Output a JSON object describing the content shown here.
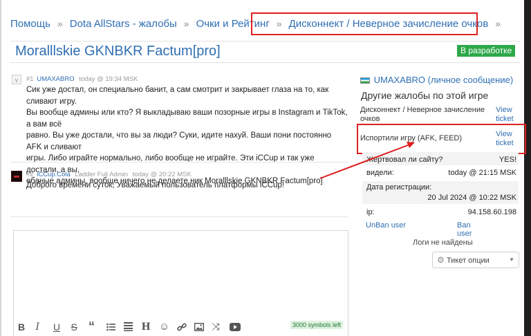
{
  "breadcrumb": {
    "items": [
      "Помощь",
      "Dota AllStars - жалобы",
      "Очки и Рейтинг",
      "Дисконнект / Неверное зачисление очков"
    ],
    "separator": "»"
  },
  "page": {
    "title": "Moralllskie GKNBKR Factum[pro]",
    "status": "В разработке"
  },
  "posts": [
    {
      "num": "#1",
      "author": "UMAXABRO",
      "role": "",
      "time": "today @ 19:34 MSK",
      "lines": [
        "Сик уже достал, он специально банит, а сам смотрит и закрывает глаза на то, как сливают игру.",
        "Вы вообще админы или кто? Я выкладываю ваши позорные игры в Instagram и TikTok, а вам всё",
        "равно. Вы уже достали, что вы за люди? Суки, идите нахуй. Ваши пони постоянно AFK и сливают",
        "игры. Либо играйте нормально, либо вообще не играйте. Эти iCCup и так уже достали, а вы,",
        "ебаные админы, вообще ничего не делаете ник Moralllskie GKNBKR Factum[pro]"
      ]
    },
    {
      "num": "#2",
      "author": "iCCup.Cola",
      "role": "Ladder Full Admin",
      "time": "today @ 20:22 MSK",
      "lines": [
        "Доброго времени суток, Уважаемый пользователь платформы iCCup!"
      ]
    }
  ],
  "editor": {
    "symbols_left": "3000 symbols left"
  },
  "sidebar": {
    "user_link": "UMAXABRO (личное сообщение)",
    "other_heading": "Другие жалобы по этой игре",
    "complaints": [
      {
        "title": "Дисконнект / Неверное зачисление очков",
        "link": "View ticket"
      },
      {
        "title": "Испортили игру (AFK, FEED)",
        "link": "View ticket"
      }
    ],
    "info": [
      {
        "label": "Жертвовал ли сайту?",
        "value": "YES!"
      },
      {
        "label": "видели:",
        "value": "today @ 21:15 MSK"
      },
      {
        "label": "Дата регистрации:",
        "value": "20 Jul 2024 @ 10:22 MSK"
      },
      {
        "label": "ip:",
        "value": "94.158.60.198"
      }
    ],
    "unban": "UnBan user",
    "ban": "Ban user",
    "logs": "Логи не найдены",
    "ticket_options": "Тикет опции"
  },
  "colors": {
    "link": "#2f6fb3",
    "badge": "#2ea84a",
    "annotation": "#e02020"
  }
}
